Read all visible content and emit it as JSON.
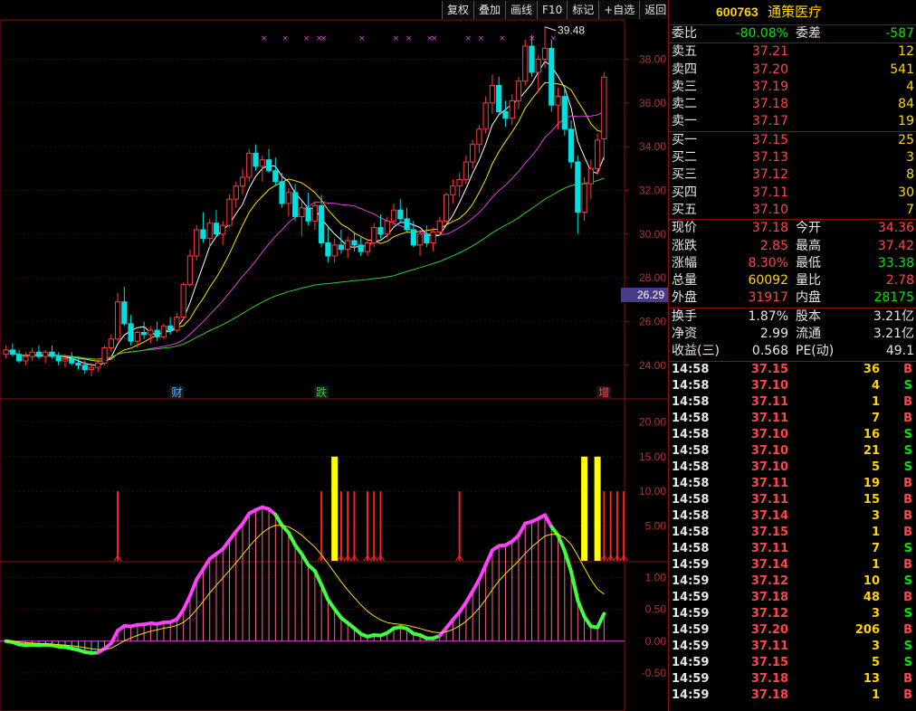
{
  "toolbar": {
    "buttons": [
      "复权",
      "叠加",
      "画线",
      "F10",
      "标记",
      "+自选",
      "返回"
    ]
  },
  "quote": {
    "code": "600763",
    "name": "通策医疗",
    "weibi_label": "委比",
    "weibi": "-80.08%",
    "weicha_label": "委差",
    "weicha": "-587",
    "asks": [
      {
        "label": "卖五",
        "price": "37.21",
        "vol": "12"
      },
      {
        "label": "卖四",
        "price": "37.20",
        "vol": "541"
      },
      {
        "label": "卖三",
        "price": "37.19",
        "vol": "4"
      },
      {
        "label": "卖二",
        "price": "37.18",
        "vol": "84"
      },
      {
        "label": "卖一",
        "price": "37.17",
        "vol": "19"
      }
    ],
    "bids": [
      {
        "label": "买一",
        "price": "37.15",
        "vol": "25"
      },
      {
        "label": "买二",
        "price": "37.13",
        "vol": "3"
      },
      {
        "label": "买三",
        "price": "37.12",
        "vol": "8"
      },
      {
        "label": "买四",
        "price": "37.11",
        "vol": "30"
      },
      {
        "label": "买五",
        "price": "37.10",
        "vol": "7"
      }
    ],
    "stats": [
      {
        "l1": "现价",
        "v1": "37.18",
        "c1": "red",
        "l2": "今开",
        "v2": "34.36",
        "c2": "red"
      },
      {
        "l1": "涨跌",
        "v1": "2.85",
        "c1": "red",
        "l2": "最高",
        "v2": "37.42",
        "c2": "red"
      },
      {
        "l1": "涨幅",
        "v1": "8.30%",
        "c1": "red",
        "l2": "最低",
        "v2": "33.38",
        "c2": "grn"
      },
      {
        "l1": "总量",
        "v1": "60092",
        "c1": "yel",
        "l2": "量比",
        "v2": "2.78",
        "c2": "red"
      },
      {
        "l1": "外盘",
        "v1": "31917",
        "c1": "red",
        "l2": "内盘",
        "v2": "28175",
        "c2": "grn"
      }
    ],
    "fund": [
      {
        "l1": "换手",
        "v1": "1.87%",
        "l2": "股本",
        "v2": "3.21亿"
      },
      {
        "l1": "净资",
        "v1": "2.99",
        "l2": "流通",
        "v2": "3.21亿"
      },
      {
        "l1": "收益(三)",
        "v1": "0.568",
        "l2": "PE(动)",
        "v2": "49.1"
      }
    ]
  },
  "ticks": [
    {
      "t": "14:58",
      "p": "37.15",
      "v": "36",
      "s": "B"
    },
    {
      "t": "14:58",
      "p": "37.10",
      "v": "4",
      "s": "S"
    },
    {
      "t": "14:58",
      "p": "37.11",
      "v": "1",
      "s": "B"
    },
    {
      "t": "14:58",
      "p": "37.11",
      "v": "7",
      "s": "B"
    },
    {
      "t": "14:58",
      "p": "37.10",
      "v": "16",
      "s": "S"
    },
    {
      "t": "14:58",
      "p": "37.10",
      "v": "21",
      "s": "S"
    },
    {
      "t": "14:58",
      "p": "37.10",
      "v": "5",
      "s": "S"
    },
    {
      "t": "14:58",
      "p": "37.11",
      "v": "19",
      "s": "B"
    },
    {
      "t": "14:58",
      "p": "37.11",
      "v": "15",
      "s": "B"
    },
    {
      "t": "14:58",
      "p": "37.14",
      "v": "3",
      "s": "B"
    },
    {
      "t": "14:58",
      "p": "37.15",
      "v": "1",
      "s": "B"
    },
    {
      "t": "14:58",
      "p": "37.11",
      "v": "7",
      "s": "S"
    },
    {
      "t": "14:59",
      "p": "37.14",
      "v": "1",
      "s": "B"
    },
    {
      "t": "14:59",
      "p": "37.12",
      "v": "10",
      "s": "S"
    },
    {
      "t": "14:59",
      "p": "37.18",
      "v": "48",
      "s": "B"
    },
    {
      "t": "14:59",
      "p": "37.12",
      "v": "3",
      "s": "S"
    },
    {
      "t": "14:59",
      "p": "37.20",
      "v": "206",
      "s": "B"
    },
    {
      "t": "14:59",
      "p": "37.11",
      "v": "3",
      "s": "S"
    },
    {
      "t": "14:59",
      "p": "37.15",
      "v": "5",
      "s": "S"
    },
    {
      "t": "14:59",
      "p": "37.18",
      "v": "13",
      "s": "B"
    },
    {
      "t": "14:59",
      "p": "37.18",
      "v": "1",
      "s": "B"
    }
  ],
  "chart_data": [
    {
      "type": "candlestick",
      "price_axis_ticks": [
        24,
        26,
        28,
        30,
        32,
        34,
        36,
        38
      ],
      "ylim": [
        22.5,
        39.8
      ],
      "high_marker": "39.48",
      "current_label": "26.29",
      "event_markers": [
        "财",
        "跌",
        "增"
      ],
      "candles": [
        [
          24.5,
          24.9,
          24.3,
          24.7
        ],
        [
          24.7,
          25.0,
          24.4,
          24.5
        ],
        [
          24.5,
          24.7,
          24.1,
          24.2
        ],
        [
          24.2,
          24.6,
          24.0,
          24.4
        ],
        [
          24.4,
          24.8,
          24.2,
          24.6
        ],
        [
          24.6,
          24.9,
          24.3,
          24.4
        ],
        [
          24.4,
          24.7,
          24.1,
          24.6
        ],
        [
          24.6,
          24.9,
          24.3,
          24.4
        ],
        [
          24.4,
          24.6,
          24.0,
          24.2
        ],
        [
          24.2,
          24.5,
          23.9,
          24.3
        ],
        [
          24.3,
          24.6,
          24.0,
          24.1
        ],
        [
          24.1,
          24.4,
          23.8,
          24.0
        ],
        [
          24.0,
          24.2,
          23.6,
          23.8
        ],
        [
          23.8,
          24.1,
          23.5,
          23.9
        ],
        [
          23.9,
          24.3,
          23.7,
          24.1
        ],
        [
          24.1,
          24.9,
          24.0,
          24.8
        ],
        [
          24.8,
          25.4,
          24.6,
          25.2
        ],
        [
          25.2,
          27.3,
          25.1,
          26.9
        ],
        [
          26.9,
          27.6,
          25.8,
          25.9
        ],
        [
          25.9,
          26.3,
          24.9,
          25.1
        ],
        [
          25.1,
          25.6,
          24.8,
          25.5
        ],
        [
          25.5,
          26.0,
          25.2,
          25.4
        ],
        [
          25.4,
          25.8,
          25.0,
          25.6
        ],
        [
          25.6,
          26.0,
          25.1,
          25.3
        ],
        [
          25.3,
          25.9,
          25.2,
          25.8
        ],
        [
          25.8,
          26.2,
          25.4,
          25.6
        ],
        [
          25.6,
          26.4,
          25.5,
          26.2
        ],
        [
          26.2,
          27.8,
          26.1,
          27.7
        ],
        [
          27.7,
          29.3,
          27.6,
          29.0
        ],
        [
          29.0,
          30.4,
          28.8,
          30.2
        ],
        [
          30.2,
          31.0,
          29.6,
          29.8
        ],
        [
          29.8,
          30.7,
          29.4,
          30.5
        ],
        [
          30.5,
          31.1,
          29.9,
          30.0
        ],
        [
          30.0,
          30.6,
          29.5,
          30.4
        ],
        [
          30.4,
          31.8,
          30.3,
          31.6
        ],
        [
          31.6,
          32.4,
          31.2,
          32.2
        ],
        [
          32.2,
          33.0,
          31.8,
          32.6
        ],
        [
          32.6,
          33.9,
          32.4,
          33.7
        ],
        [
          33.7,
          34.1,
          32.9,
          33.1
        ],
        [
          33.1,
          33.6,
          32.4,
          33.4
        ],
        [
          33.4,
          33.9,
          32.8,
          32.9
        ],
        [
          32.9,
          33.5,
          32.2,
          32.4
        ],
        [
          32.4,
          32.8,
          31.2,
          31.4
        ],
        [
          31.4,
          32.1,
          30.8,
          31.9
        ],
        [
          31.9,
          32.3,
          30.6,
          30.8
        ],
        [
          30.8,
          31.5,
          29.9,
          31.2
        ],
        [
          31.2,
          31.9,
          30.4,
          30.6
        ],
        [
          30.6,
          31.5,
          30.2,
          31.3
        ],
        [
          31.3,
          31.8,
          29.4,
          29.6
        ],
        [
          29.6,
          30.3,
          28.7,
          29.0
        ],
        [
          29.0,
          29.8,
          28.7,
          29.5
        ],
        [
          29.5,
          30.2,
          29.1,
          29.3
        ],
        [
          29.3,
          29.9,
          28.9,
          29.7
        ],
        [
          29.7,
          30.1,
          29.2,
          29.5
        ],
        [
          29.5,
          29.9,
          29.0,
          29.2
        ],
        [
          29.2,
          29.8,
          29.0,
          29.6
        ],
        [
          29.6,
          30.5,
          29.4,
          30.3
        ],
        [
          30.3,
          30.9,
          29.8,
          30.0
        ],
        [
          30.0,
          30.8,
          29.8,
          30.6
        ],
        [
          30.6,
          31.4,
          30.4,
          31.1
        ],
        [
          31.1,
          31.6,
          30.5,
          30.7
        ],
        [
          30.7,
          31.2,
          30.1,
          30.2
        ],
        [
          30.2,
          30.6,
          29.4,
          29.5
        ],
        [
          29.5,
          30.2,
          29.0,
          30.0
        ],
        [
          30.0,
          30.4,
          29.4,
          29.6
        ],
        [
          29.6,
          30.3,
          29.2,
          30.1
        ],
        [
          30.1,
          30.8,
          29.9,
          30.6
        ],
        [
          30.6,
          31.9,
          30.5,
          31.8
        ],
        [
          31.8,
          32.5,
          31.4,
          32.2
        ],
        [
          32.2,
          32.8,
          31.7,
          32.5
        ],
        [
          32.5,
          33.6,
          32.3,
          33.3
        ],
        [
          33.3,
          34.3,
          33.0,
          34.1
        ],
        [
          34.1,
          35.0,
          33.7,
          34.8
        ],
        [
          34.8,
          36.3,
          34.6,
          36.0
        ],
        [
          36.0,
          37.3,
          35.5,
          36.8
        ],
        [
          36.8,
          37.2,
          35.4,
          35.6
        ],
        [
          35.6,
          36.1,
          34.9,
          35.3
        ],
        [
          35.3,
          36.4,
          35.0,
          36.1
        ],
        [
          36.1,
          37.2,
          35.7,
          37.0
        ],
        [
          37.0,
          38.9,
          36.8,
          38.6
        ],
        [
          38.6,
          39.1,
          37.2,
          37.4
        ],
        [
          37.4,
          38.2,
          36.5,
          38.0
        ],
        [
          38.0,
          39.48,
          37.6,
          38.5
        ],
        [
          38.5,
          38.9,
          35.6,
          35.9
        ],
        [
          35.9,
          36.7,
          34.8,
          36.3
        ],
        [
          36.3,
          36.7,
          34.5,
          34.8
        ],
        [
          34.8,
          35.2,
          33.0,
          33.3
        ],
        [
          33.3,
          33.6,
          30.0,
          31.0
        ],
        [
          31.0,
          32.6,
          30.6,
          32.3
        ],
        [
          32.3,
          33.4,
          31.6,
          33.0
        ],
        [
          33.0,
          34.6,
          32.7,
          34.3
        ],
        [
          34.36,
          37.42,
          33.38,
          37.18
        ]
      ]
    },
    {
      "type": "bar",
      "title": "signal_volume",
      "y_axis_ticks": [
        5,
        10,
        15,
        20
      ],
      "ylim": [
        0,
        22
      ],
      "bars": [
        {
          "i": 17,
          "v": 10,
          "color": "red"
        },
        {
          "i": 48,
          "v": 10,
          "color": "red"
        },
        {
          "i": 50,
          "v": 15,
          "color": "yellow"
        },
        {
          "i": 51,
          "v": 10,
          "color": "red"
        },
        {
          "i": 52,
          "v": 10,
          "color": "red"
        },
        {
          "i": 53,
          "v": 10,
          "color": "red"
        },
        {
          "i": 55,
          "v": 10,
          "color": "red"
        },
        {
          "i": 56,
          "v": 10,
          "color": "red"
        },
        {
          "i": 57,
          "v": 10,
          "color": "red"
        },
        {
          "i": 69,
          "v": 10,
          "color": "red"
        },
        {
          "i": 88,
          "v": 15,
          "color": "yellow"
        },
        {
          "i": 90,
          "v": 15,
          "color": "yellow"
        },
        {
          "i": 91,
          "v": 10,
          "color": "red"
        },
        {
          "i": 92,
          "v": 10,
          "color": "red"
        },
        {
          "i": 93,
          "v": 10,
          "color": "red"
        },
        {
          "i": 94,
          "v": 10,
          "color": "red"
        }
      ]
    },
    {
      "type": "line",
      "title": "macd",
      "y_axis_ticks": [
        -0.5,
        0.0,
        0.5,
        1.0
      ],
      "ylim": [
        -1.1,
        1.25
      ]
    }
  ]
}
